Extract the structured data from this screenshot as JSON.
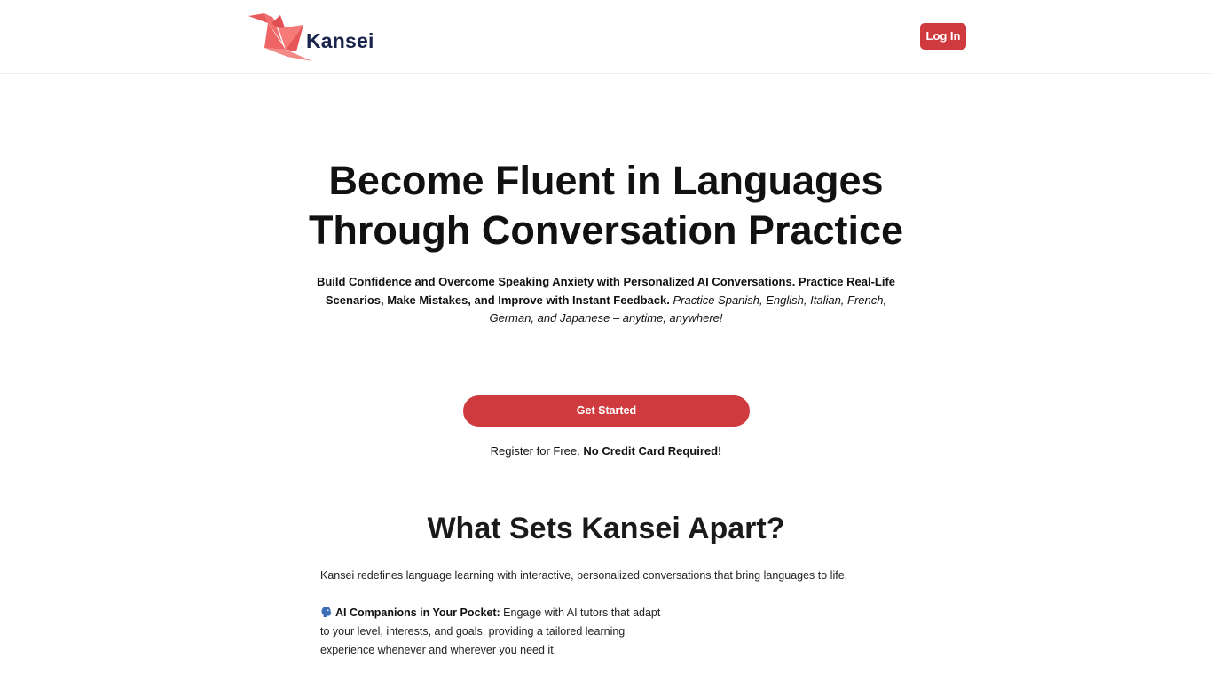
{
  "header": {
    "logo_text": "Kansei",
    "login_label": "Log In"
  },
  "hero": {
    "title_line1": "Become Fluent in Languages",
    "title_line2": "Through Conversation Practice",
    "subtitle_bold": "Build Confidence and Overcome Speaking Anxiety with Personalized AI Conversations. Practice Real-Life Scenarios, Make Mistakes, and Improve with Instant Feedback.",
    "subtitle_italic": "Practice Spanish, English, Italian, French, German, and Japanese – anytime, anywhere!",
    "cta_label": "Get Started",
    "register_text": "Register for Free.",
    "register_bold": "No Credit Card Required!"
  },
  "section": {
    "title": "What Sets Kansei Apart?",
    "intro": "Kansei redefines language learning with interactive, personalized conversations that bring languages to life.",
    "features": [
      {
        "icon": "speaking-head-icon",
        "title": "AI Companions in Your Pocket:",
        "text": "Engage with AI tutors that adapt to your level, interests, and goals, providing a tailored learning experience whenever and wherever you need it."
      }
    ]
  },
  "colors": {
    "accent": "#cf3a3f",
    "logo_text": "#17234a",
    "crane": "#f26d6d"
  }
}
